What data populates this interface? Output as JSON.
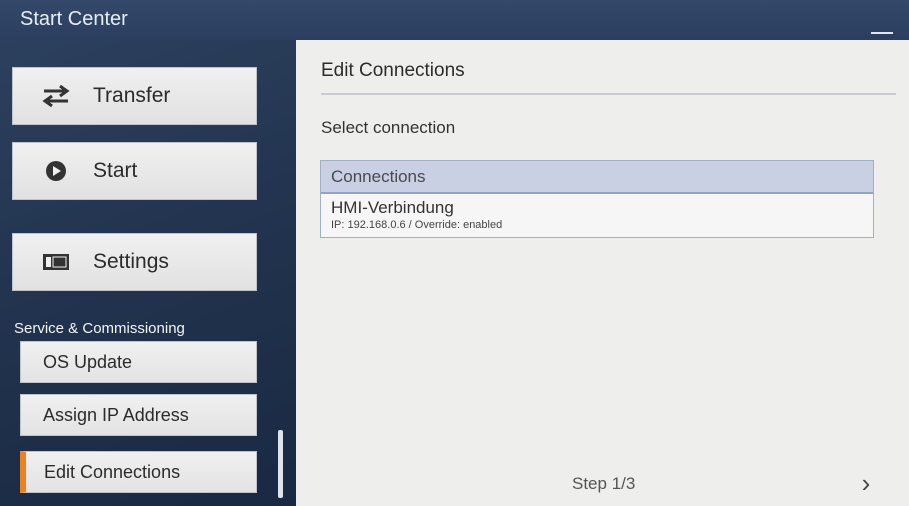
{
  "window": {
    "title": "Start Center"
  },
  "sidebar": {
    "buttons": [
      {
        "label": "Transfer",
        "icon": "transfer-arrows-icon"
      },
      {
        "label": "Start",
        "icon": "play-icon"
      },
      {
        "label": "Settings",
        "icon": "settings-panel-icon"
      }
    ],
    "section_label": "Service & Commissioning",
    "sub_items": [
      {
        "label": "OS Update",
        "active": false
      },
      {
        "label": "Assign IP Address",
        "active": false
      },
      {
        "label": "Edit Connections",
        "active": true
      }
    ],
    "active_accent": "#e9821f"
  },
  "main": {
    "title": "Edit Connections",
    "subtitle": "Select connection",
    "table": {
      "header": "Connections",
      "rows": [
        {
          "name": "HMI-Verbindung",
          "detail": "IP: 192.168.0.6 / Override: enabled"
        }
      ]
    },
    "step": "Step 1/3",
    "next_glyph": "›"
  }
}
